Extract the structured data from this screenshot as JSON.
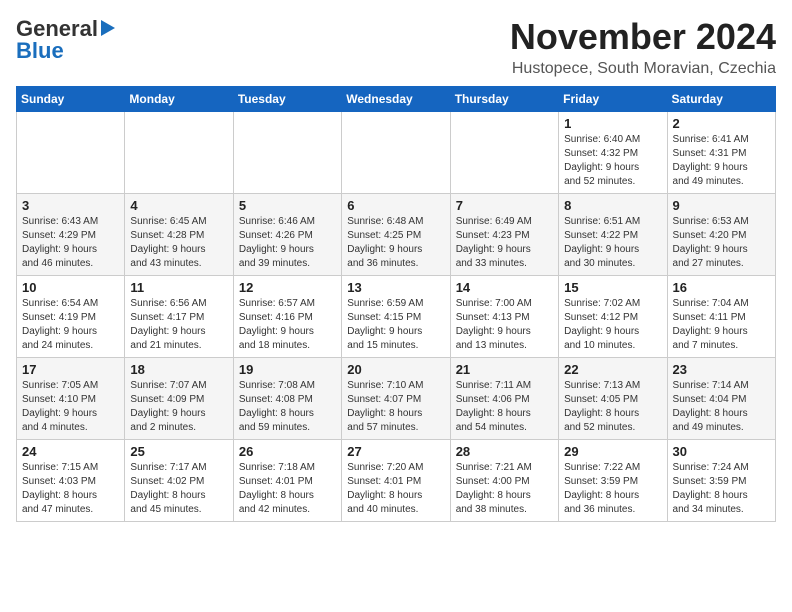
{
  "header": {
    "logo_line1": "General",
    "logo_line2": "Blue",
    "month": "November 2024",
    "location": "Hustopece, South Moravian, Czechia"
  },
  "weekdays": [
    "Sunday",
    "Monday",
    "Tuesday",
    "Wednesday",
    "Thursday",
    "Friday",
    "Saturday"
  ],
  "weeks": [
    [
      {
        "day": "",
        "info": ""
      },
      {
        "day": "",
        "info": ""
      },
      {
        "day": "",
        "info": ""
      },
      {
        "day": "",
        "info": ""
      },
      {
        "day": "",
        "info": ""
      },
      {
        "day": "1",
        "info": "Sunrise: 6:40 AM\nSunset: 4:32 PM\nDaylight: 9 hours\nand 52 minutes."
      },
      {
        "day": "2",
        "info": "Sunrise: 6:41 AM\nSunset: 4:31 PM\nDaylight: 9 hours\nand 49 minutes."
      }
    ],
    [
      {
        "day": "3",
        "info": "Sunrise: 6:43 AM\nSunset: 4:29 PM\nDaylight: 9 hours\nand 46 minutes."
      },
      {
        "day": "4",
        "info": "Sunrise: 6:45 AM\nSunset: 4:28 PM\nDaylight: 9 hours\nand 43 minutes."
      },
      {
        "day": "5",
        "info": "Sunrise: 6:46 AM\nSunset: 4:26 PM\nDaylight: 9 hours\nand 39 minutes."
      },
      {
        "day": "6",
        "info": "Sunrise: 6:48 AM\nSunset: 4:25 PM\nDaylight: 9 hours\nand 36 minutes."
      },
      {
        "day": "7",
        "info": "Sunrise: 6:49 AM\nSunset: 4:23 PM\nDaylight: 9 hours\nand 33 minutes."
      },
      {
        "day": "8",
        "info": "Sunrise: 6:51 AM\nSunset: 4:22 PM\nDaylight: 9 hours\nand 30 minutes."
      },
      {
        "day": "9",
        "info": "Sunrise: 6:53 AM\nSunset: 4:20 PM\nDaylight: 9 hours\nand 27 minutes."
      }
    ],
    [
      {
        "day": "10",
        "info": "Sunrise: 6:54 AM\nSunset: 4:19 PM\nDaylight: 9 hours\nand 24 minutes."
      },
      {
        "day": "11",
        "info": "Sunrise: 6:56 AM\nSunset: 4:17 PM\nDaylight: 9 hours\nand 21 minutes."
      },
      {
        "day": "12",
        "info": "Sunrise: 6:57 AM\nSunset: 4:16 PM\nDaylight: 9 hours\nand 18 minutes."
      },
      {
        "day": "13",
        "info": "Sunrise: 6:59 AM\nSunset: 4:15 PM\nDaylight: 9 hours\nand 15 minutes."
      },
      {
        "day": "14",
        "info": "Sunrise: 7:00 AM\nSunset: 4:13 PM\nDaylight: 9 hours\nand 13 minutes."
      },
      {
        "day": "15",
        "info": "Sunrise: 7:02 AM\nSunset: 4:12 PM\nDaylight: 9 hours\nand 10 minutes."
      },
      {
        "day": "16",
        "info": "Sunrise: 7:04 AM\nSunset: 4:11 PM\nDaylight: 9 hours\nand 7 minutes."
      }
    ],
    [
      {
        "day": "17",
        "info": "Sunrise: 7:05 AM\nSunset: 4:10 PM\nDaylight: 9 hours\nand 4 minutes."
      },
      {
        "day": "18",
        "info": "Sunrise: 7:07 AM\nSunset: 4:09 PM\nDaylight: 9 hours\nand 2 minutes."
      },
      {
        "day": "19",
        "info": "Sunrise: 7:08 AM\nSunset: 4:08 PM\nDaylight: 8 hours\nand 59 minutes."
      },
      {
        "day": "20",
        "info": "Sunrise: 7:10 AM\nSunset: 4:07 PM\nDaylight: 8 hours\nand 57 minutes."
      },
      {
        "day": "21",
        "info": "Sunrise: 7:11 AM\nSunset: 4:06 PM\nDaylight: 8 hours\nand 54 minutes."
      },
      {
        "day": "22",
        "info": "Sunrise: 7:13 AM\nSunset: 4:05 PM\nDaylight: 8 hours\nand 52 minutes."
      },
      {
        "day": "23",
        "info": "Sunrise: 7:14 AM\nSunset: 4:04 PM\nDaylight: 8 hours\nand 49 minutes."
      }
    ],
    [
      {
        "day": "24",
        "info": "Sunrise: 7:15 AM\nSunset: 4:03 PM\nDaylight: 8 hours\nand 47 minutes."
      },
      {
        "day": "25",
        "info": "Sunrise: 7:17 AM\nSunset: 4:02 PM\nDaylight: 8 hours\nand 45 minutes."
      },
      {
        "day": "26",
        "info": "Sunrise: 7:18 AM\nSunset: 4:01 PM\nDaylight: 8 hours\nand 42 minutes."
      },
      {
        "day": "27",
        "info": "Sunrise: 7:20 AM\nSunset: 4:01 PM\nDaylight: 8 hours\nand 40 minutes."
      },
      {
        "day": "28",
        "info": "Sunrise: 7:21 AM\nSunset: 4:00 PM\nDaylight: 8 hours\nand 38 minutes."
      },
      {
        "day": "29",
        "info": "Sunrise: 7:22 AM\nSunset: 3:59 PM\nDaylight: 8 hours\nand 36 minutes."
      },
      {
        "day": "30",
        "info": "Sunrise: 7:24 AM\nSunset: 3:59 PM\nDaylight: 8 hours\nand 34 minutes."
      }
    ]
  ]
}
